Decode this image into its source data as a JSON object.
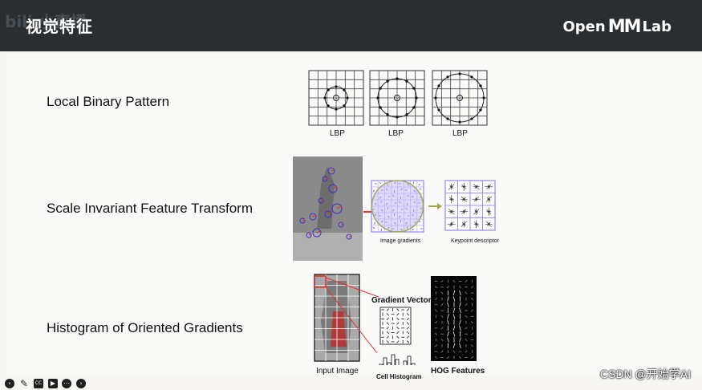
{
  "header": {
    "title": "视觉特征",
    "logo_left": "Open",
    "logo_mid": "MM",
    "logo_right": "Lab",
    "watermark": "bili 小直播"
  },
  "rows": [
    {
      "label": "Local Binary Pattern",
      "captions": [
        "LBP",
        "LBP",
        "LBP"
      ]
    },
    {
      "label": "Scale Invariant Feature Transform",
      "captions": [
        "Image gradients",
        "Keypoint descriptor"
      ]
    },
    {
      "label": "Histogram of Oriented Gradients",
      "captions": [
        "Input Image",
        "Gradient Vector",
        "Cell Histogram",
        "HOG Features"
      ]
    }
  ],
  "footer": {
    "watermark": "CSDN @开始学AI"
  },
  "colors": {
    "accent": "#5a4fe0",
    "red": "#e2302b",
    "olive": "#a7a64c",
    "dark": "#2b2e30"
  }
}
